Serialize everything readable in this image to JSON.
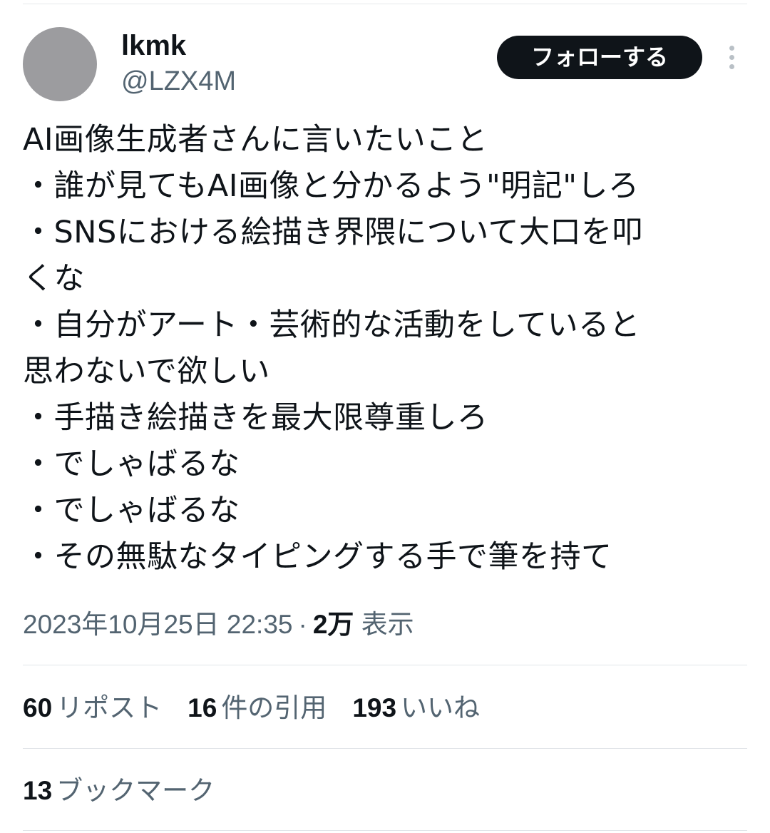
{
  "user": {
    "display_name": "lkmk",
    "handle": "@LZX4M",
    "follow_label": "フォローする",
    "more_icon": "more-vertical-icon"
  },
  "tweet": {
    "lines": [
      "AI画像生成者さんに言いたいこと",
      "・誰が見てもAI画像と分かるよう\"明記\"しろ",
      "・SNSにおける絵描き界隈について大口を叩",
      "くな",
      "・自分がアート・芸術的な活動をしていると",
      "思わないで欲しい",
      "・手描き絵描きを最大限尊重しろ",
      "・でしゃばるな",
      "・でしゃばるな",
      "・その無駄なタイピングする手で筆を持て"
    ]
  },
  "meta": {
    "timestamp": "2023年10月25日 22:35",
    "separator": "·",
    "views_count": "2万",
    "views_label": "表示"
  },
  "stats": {
    "reposts": {
      "count": "60",
      "label": "リポスト"
    },
    "quotes": {
      "count": "16",
      "label": "件の引用"
    },
    "likes": {
      "count": "193",
      "label": "いいね"
    },
    "bookmarks": {
      "count": "13",
      "label": "ブックマーク"
    }
  },
  "colors": {
    "text": "#0f1419",
    "secondary": "#536471",
    "button_bg": "#0f1419",
    "avatar": "#9c9c9f",
    "divider": "#e1e5e9"
  }
}
